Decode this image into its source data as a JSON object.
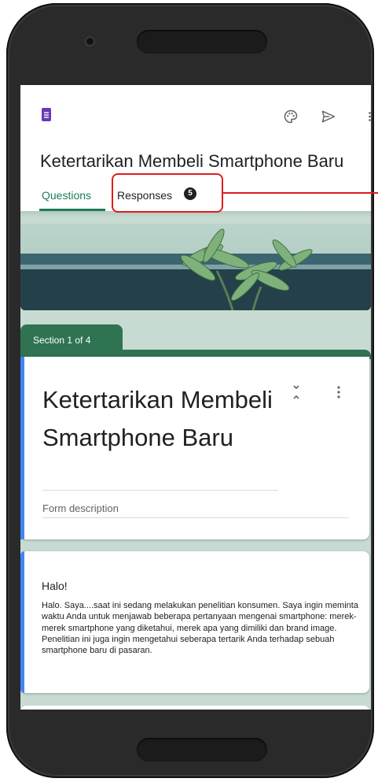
{
  "app": {
    "form_title": "Ketertarikan Membeli Smartphone Baru",
    "tabs": [
      {
        "label": "Questions",
        "active": true
      },
      {
        "label": "Responses",
        "badge": "5"
      }
    ],
    "toolbar_icons": [
      "forms-logo-icon",
      "palette-icon",
      "send-icon",
      "more-vert-icon"
    ],
    "accent_color": "#1b7e53"
  },
  "section": {
    "label": "Section 1 of 4",
    "title": "Ketertarikan Membeli Smartphone Baru",
    "description_placeholder": "Form description"
  },
  "text_block": {
    "title": "Halo!",
    "body": "Halo. Saya....saat ini sedang melakukan penelitian konsumen. Saya ingin meminta waktu Anda untuk menjawab beberapa pertanyaan mengenai smartphone: merek-merek smartphone yang diketahui, merek apa yang dimiliki dan brand image. Penelitian ini juga ingin mengetahui seberapa tertarik Anda terhadap sebuah smartphone baru di pasaran."
  }
}
